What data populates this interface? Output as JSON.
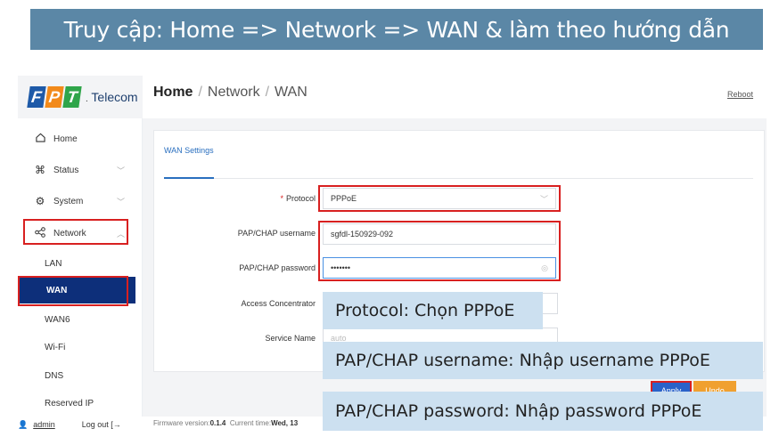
{
  "banner": {
    "text": "Truy cập: Home => Network => WAN & làm theo hướng dẫn"
  },
  "logo": {
    "f": "F",
    "p": "P",
    "t": "T",
    "brand": "Telecom",
    "dot": "."
  },
  "breadcrumb": {
    "home": "Home",
    "sep1": "/",
    "network": "Network",
    "sep2": "/",
    "wan": "WAN"
  },
  "header": {
    "reboot_label": "Reboot"
  },
  "sidebar": {
    "home": {
      "label": "Home",
      "icon": "home-icon"
    },
    "status": {
      "label": "Status",
      "icon": "command-icon"
    },
    "system": {
      "label": "System",
      "icon": "gear-icon"
    },
    "network": {
      "label": "Network",
      "icon": "share-icon"
    },
    "sub": [
      "LAN",
      "WAN",
      "WAN6",
      "Wi-Fi",
      "DNS",
      "Reserved IP"
    ],
    "admin": "admin",
    "logout": "Log out"
  },
  "card": {
    "tab": "WAN Settings",
    "protocol": {
      "label": "Protocol",
      "required": "*",
      "value": "PPPoE"
    },
    "username": {
      "label": "PAP/CHAP username",
      "value": "sgfdl-150929-092"
    },
    "password": {
      "label": "PAP/CHAP password",
      "value": "•••••••"
    },
    "access_concentrator": {
      "label": "Access Concentrator"
    },
    "service_name": {
      "label": "Service Name",
      "placeholder": "auto"
    }
  },
  "buttons": {
    "apply": "Apply",
    "undo": "Undo"
  },
  "footer": {
    "fw_label": "Firmware version:",
    "fw_value": "0.1.4",
    "time_label": "Current time:",
    "time_value": "Wed, 13"
  },
  "callouts": {
    "protocol": "Protocol: Chọn PPPoE",
    "username": "PAP/CHAP username: Nhập username PPPoE",
    "password": "PAP/CHAP password: Nhập password PPPoE"
  },
  "colors": {
    "banner": "#5b87a6",
    "active_nav": "#0d2f7a",
    "highlight": "#d82020",
    "callout": "#cce0f0",
    "apply": "#2a62c9",
    "undo": "#f0a030"
  }
}
